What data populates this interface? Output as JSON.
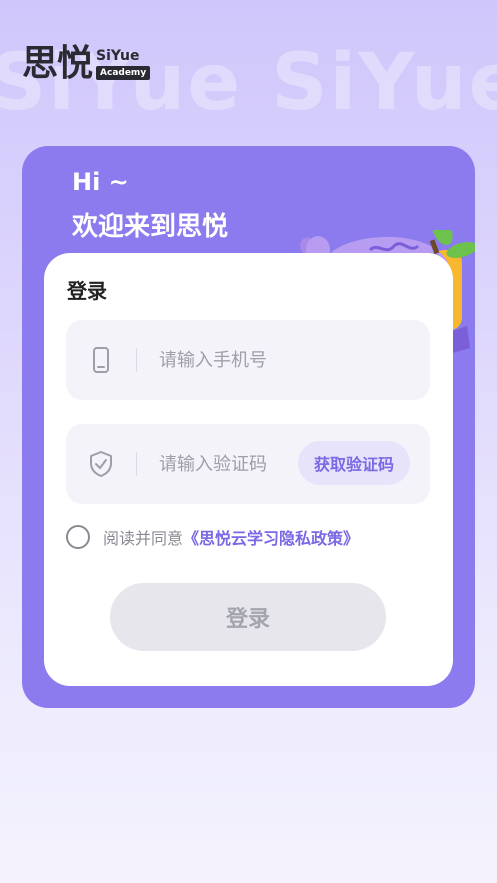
{
  "background_watermark": "SiYue SiYue",
  "brand": {
    "name_cn": "思悦",
    "name_en": "SiYue",
    "sub": "Academy"
  },
  "greeting": {
    "hi": "Hi ~",
    "welcome": "欢迎来到思悦"
  },
  "login": {
    "title": "登录",
    "phone": {
      "placeholder": "请输入手机号",
      "value": "",
      "icon": "phone-icon"
    },
    "code": {
      "placeholder": "请输入验证码",
      "value": "",
      "icon": "shield-icon",
      "button": "获取验证码"
    },
    "agreement": {
      "prefix": "阅读并同意",
      "link": "《思悦云学习隐私政策》",
      "checked": false
    },
    "submit": "登录"
  },
  "colors": {
    "accent": "#8b7bee",
    "link": "#7a69e4",
    "mascot": "#b79cf2",
    "leaf": "#6cc24a",
    "button_disabled": "#e6e6ec"
  }
}
